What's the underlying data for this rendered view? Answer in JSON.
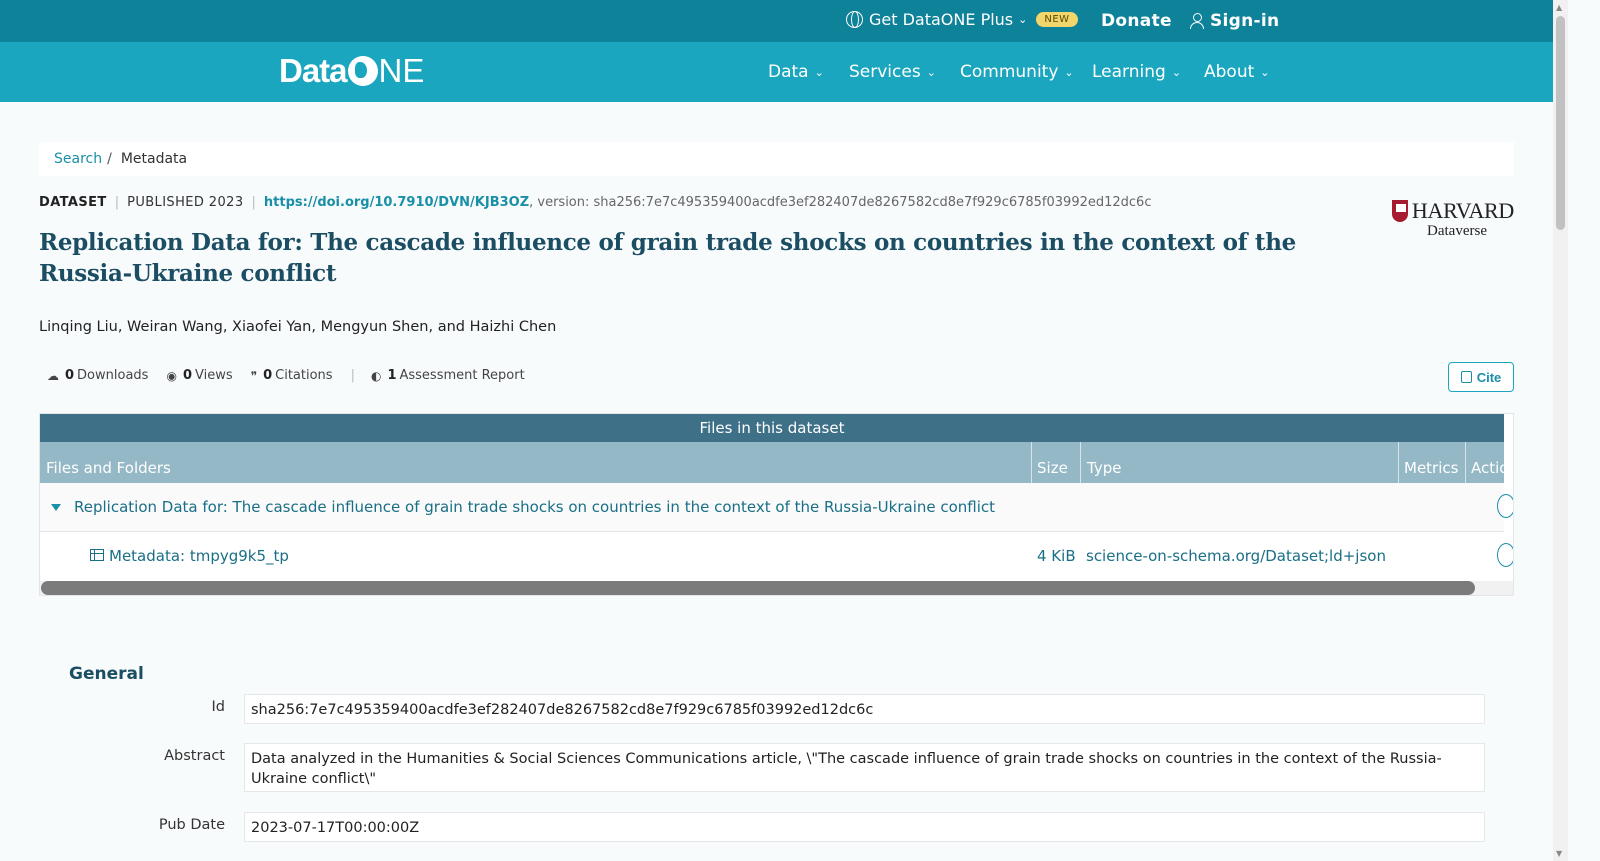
{
  "topbar": {
    "plus_label": "Get DataONE Plus",
    "plus_badge": "NEW",
    "donate": "Donate",
    "signin": "Sign-in"
  },
  "brand": {
    "logo_text_a": "Data",
    "logo_text_b": "NE"
  },
  "nav": {
    "items": [
      "Data",
      "Services",
      "Community",
      "Learning",
      "About"
    ]
  },
  "breadcrumb": {
    "search": "Search",
    "current": "Metadata"
  },
  "meta": {
    "type": "DATASET",
    "published": "PUBLISHED 2023",
    "doi": "https://doi.org/10.7910/DVN/KJB3OZ",
    "version": ", version: sha256:7e7c495359400acdfe3ef282407de8267582cd8e7f929c6785f03992ed12dc6c"
  },
  "repository": {
    "name": "HARVARD",
    "sub": "Dataverse"
  },
  "dataset": {
    "title": "Replication Data for: The cascade influence of grain trade shocks on countries in the context of the Russia-Ukraine conflict",
    "authors": "Linqing Liu, Weiran Wang, Xiaofei Yan, Mengyun Shen, and Haizhi Chen"
  },
  "stats": {
    "downloads_count": "0",
    "downloads_label": "Downloads",
    "views_count": "0",
    "views_label": "Views",
    "citations_count": "0",
    "citations_label": "Citations",
    "reports_count": "1",
    "reports_label": "Assessment Report"
  },
  "cite_label": "Cite",
  "files": {
    "caption": "Files in this dataset",
    "columns": [
      "Files and Folders",
      "Size",
      "Type",
      "Metrics",
      "Actio"
    ],
    "folder_name": "Replication Data for: The cascade influence of grain trade shocks on countries in the context of the Russia-Ukraine conflict",
    "file": {
      "name": "Metadata: tmpyg9k5_tp",
      "size": "4 KiB",
      "type": "science-on-schema.org/Dataset;ld+json"
    }
  },
  "general": {
    "heading": "General",
    "fields": [
      {
        "label": "Id",
        "value": "sha256:7e7c495359400acdfe3ef282407de8267582cd8e7f929c6785f03992ed12dc6c"
      },
      {
        "label": "Abstract",
        "value": "Data analyzed in the Humanities & Social Sciences Communications article, \\\"The cascade influence of grain trade shocks on countries in the context of the Russia-Ukraine conflict\\\""
      },
      {
        "label": "Pub Date",
        "value": "2023-07-17T00:00:00Z"
      }
    ]
  },
  "colors": {
    "topbar": "#0d8299",
    "navbar": "#1ba6bf",
    "accent": "#1a8fa8",
    "title": "#1b4d63"
  }
}
